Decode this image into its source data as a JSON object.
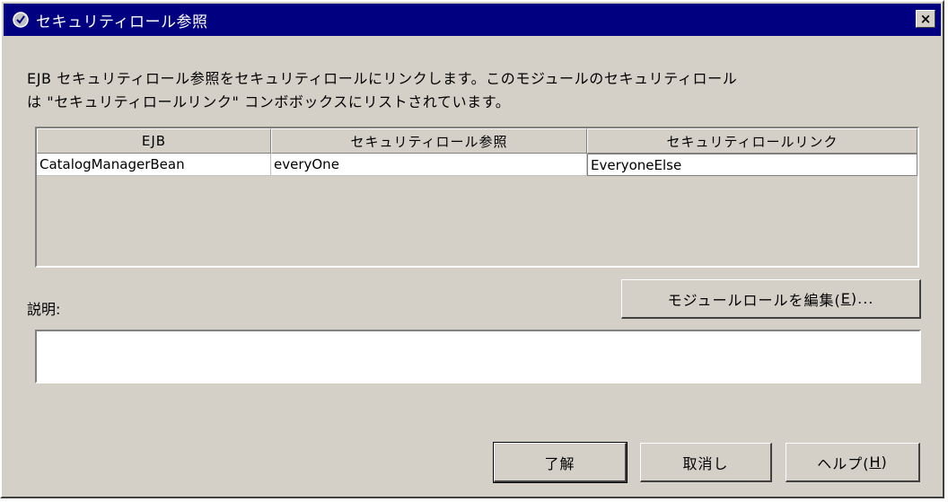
{
  "window": {
    "title": "セキュリティロール参照",
    "close_glyph": "×"
  },
  "description_text_line1": "EJB セキュリティロール参照をセキュリティロールにリンクします。このモジュールのセキュリティロール",
  "description_text_line2": "は \"セキュリティロールリンク\" コンボボックスにリストされています。",
  "table": {
    "columns": [
      "EJB",
      "セキュリティロール参照",
      "セキュリティロールリンク"
    ],
    "rows": [
      [
        "CatalogManagerBean",
        "everyOne",
        "EveryoneElse"
      ]
    ]
  },
  "description_label": "説明:",
  "description_value": "",
  "edit_module_roles_button": {
    "label_pre": "モジュールロールを編集(",
    "mnemonic": "E",
    "label_post": ")..."
  },
  "buttons": {
    "ok": "了解",
    "cancel": "取消し",
    "help_pre": "ヘルプ(",
    "help_mnemonic": "H",
    "help_post": ")"
  },
  "colors": {
    "titlebar": "#000080",
    "dialog_bg": "#d4d0c8"
  }
}
